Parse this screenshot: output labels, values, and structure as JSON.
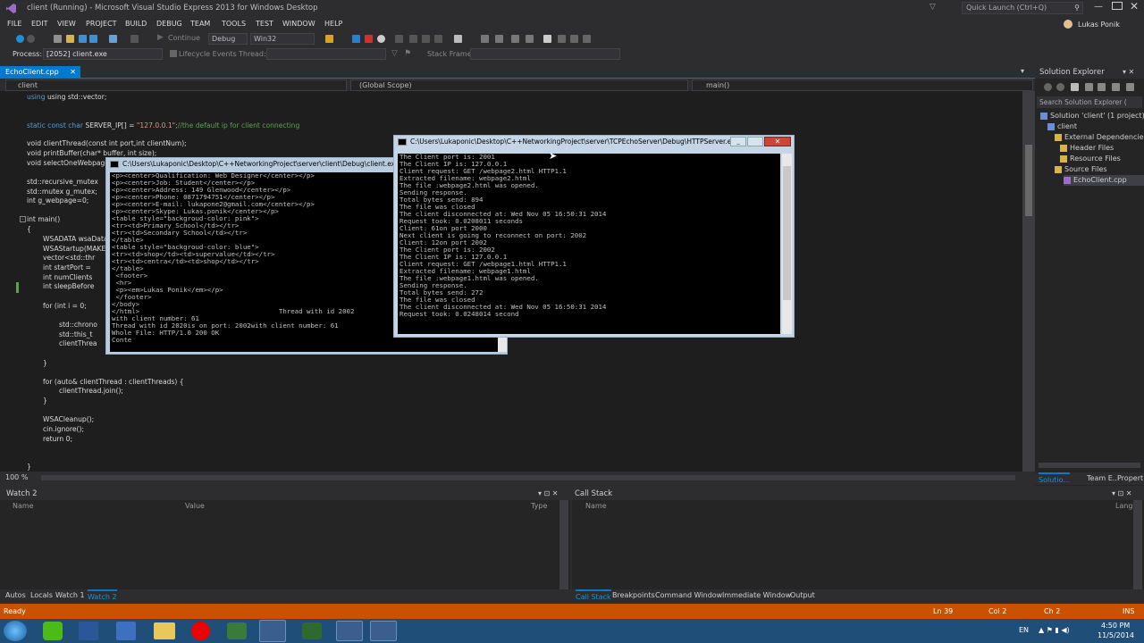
{
  "window": {
    "title": "client (Running) - Microsoft Visual Studio Express 2013 for Windows Desktop",
    "quick_launch_placeholder": "Quick Launch (Ctrl+Q)",
    "user": "Lukas Ponik"
  },
  "menu": [
    "FILE",
    "EDIT",
    "VIEW",
    "PROJECT",
    "BUILD",
    "DEBUG",
    "TEAM",
    "TOOLS",
    "TEST",
    "WINDOW",
    "HELP"
  ],
  "toolbar": {
    "continue_label": "Continue",
    "config": "Debug",
    "platform": "Win32"
  },
  "debug_toolbar": {
    "process_label": "Process:",
    "process_value": "[2052] client.exe",
    "lifecycle_label": "Lifecycle Events",
    "thread_label": "Thread:",
    "stack_frame_label": "Stack Frame:"
  },
  "doc_tab": "EchoClient.cpp",
  "nav": {
    "project": "client",
    "scope": "(Global Scope)",
    "member": "main()"
  },
  "code": {
    "l1": "using std::vector;",
    "l2a": "static const char ",
    "l2b": "SERVER_IP[] = ",
    "l2c": "\"127.0.0.1\";",
    "l2d": "//the default ip for client connecting",
    "l3": "void clientThread(const int port,int clientNum);",
    "l4": "void printBuffer(char* buffer, int size);",
    "l5": "void selectOneWebpage",
    "l6": "std::recursive_mutex",
    "l7": "std::mutex g_mutex;",
    "l8": "int g_webpage=0;",
    "l9": "int main()",
    "l10": "{",
    "l11": "WSADATA wsaData",
    "l12": "WSAStartup(MAKEW",
    "l13": "vector<std::thr",
    "l14": "int startPort =",
    "l15": "int numClients",
    "l16": "int sleepBefore",
    "l17": "for (int i = 0;",
    "l18": "std::chrono",
    "l19": "std::this_t",
    "l20": "clientThrea",
    "l21": "}",
    "l22": "for (auto& clientThread : clientThreads) {",
    "l23": "clientThread.join();",
    "l24": "}",
    "l25": "WSACleanup();",
    "l26": "cin.ignore();",
    "l27": "return 0;",
    "l28": "}"
  },
  "zoom": "100 %",
  "client_console": {
    "title": "C:\\Users\\Lukaponic\\Desktop\\C++NetworkingProject\\server\\client\\Debug\\client.exe",
    "lines": [
      "<p><center>Qualification: Web Designer</center></p>",
      "<p><center>Job: Student</center></p>",
      "<p><center>Address: 149 Glenwood</center></p>",
      "<p><center>Phone: 0871794751</center></p>",
      "<p><center>E-mail: lukapone2@gmail.com</center></p>",
      "<p><center>Skype: Lukas.ponik</center></p>",
      "<table style=\"backgroud-color: pink\">",
      "<tr><td>Primary School</td></tr>",
      "<tr><td>Secondary School</td></tr>",
      "</table>",
      "<table style=\"backgroud-color: blue\">",
      "<tr><td>shop</td><td>supervalue</td></tr>",
      "<tr><td>centra</td><td>shop</td></tr>",
      "</table>",
      "",
      " <footer>",
      " <hr>",
      " <p><em>Lukas Ponik</em></p>",
      " </footer>",
      "</body>",
      "</html>                                   Thread with id 2002",
      "with client number: 61",
      "Thread with id 2020is on port: 2002with client number: 61",
      "Whole File: HTTP/1.0 200 OK",
      "Conte"
    ]
  },
  "server_console": {
    "title": "C:\\Users\\Lukaponic\\Desktop\\C++NetworkingProject\\server\\TCPEchoServer\\Debug\\HTTPServer.exe",
    "lines": [
      "The Client port is: 2001",
      "The Client IP is: 127.0.0.1",
      "Client request: GET /webpage2.html HTTP1.1",
      "Extracted filename: webpage2.html",
      "The file :webpage2.html was opened.",
      "Sending response.",
      "Total bytes send: 894",
      "The file was closed",
      "The client disconnected at: Wed Nov 05 16:50:31 2014",
      "Request took: 0.0208011 seconds",
      "Client: 61on port 2000",
      "",
      "Next client is going to reconnect on port: 2002",
      "Client: 12on port 2002",
      "The Client port is: 2002",
      "The Client IP is: 127.0.0.1",
      "Client request: GET /webpage1.html HTTP1.1",
      "Extracted filename: webpage1.html",
      "The file :webpage1.html was opened.",
      "Sending response.",
      "Total bytes send: 272",
      "The file was closed",
      "The client disconnected at: Wed Nov 05 16:50:31 2014",
      "Request took: 0.0248014 second"
    ]
  },
  "solution_explorer": {
    "title": "Solution Explorer",
    "search_placeholder": "Search Solution Explorer (",
    "items": [
      "Solution 'client' (1 project)",
      "client",
      "External Dependencie",
      "Header Files",
      "Resource Files",
      "Source Files",
      "EchoClient.cpp"
    ],
    "tabs": [
      "Solutio...",
      "Team E...",
      "Propert..."
    ]
  },
  "watch": {
    "title": "Watch 2",
    "cols": [
      "Name",
      "Value",
      "Type"
    ]
  },
  "callstack": {
    "title": "Call Stack",
    "cols": [
      "Name",
      "Lang"
    ]
  },
  "bottom_tabs_left": [
    "Autos",
    "Locals",
    "Watch 1",
    "Watch 2"
  ],
  "bottom_tabs_right": [
    "Call Stack",
    "Breakpoints",
    "Command Window",
    "Immediate Window",
    "Output"
  ],
  "status": {
    "ready": "Ready",
    "ln": "Ln 39",
    "col": "Col 2",
    "ch": "Ch 2",
    "ins": "INS"
  },
  "taskbar": {
    "lang": "EN",
    "time": "4:50 PM",
    "date": "11/5/2014"
  },
  "colors": {
    "accent": "#007acc",
    "status_debug": "#ca5100",
    "editor_bg": "#1e1e1e"
  }
}
